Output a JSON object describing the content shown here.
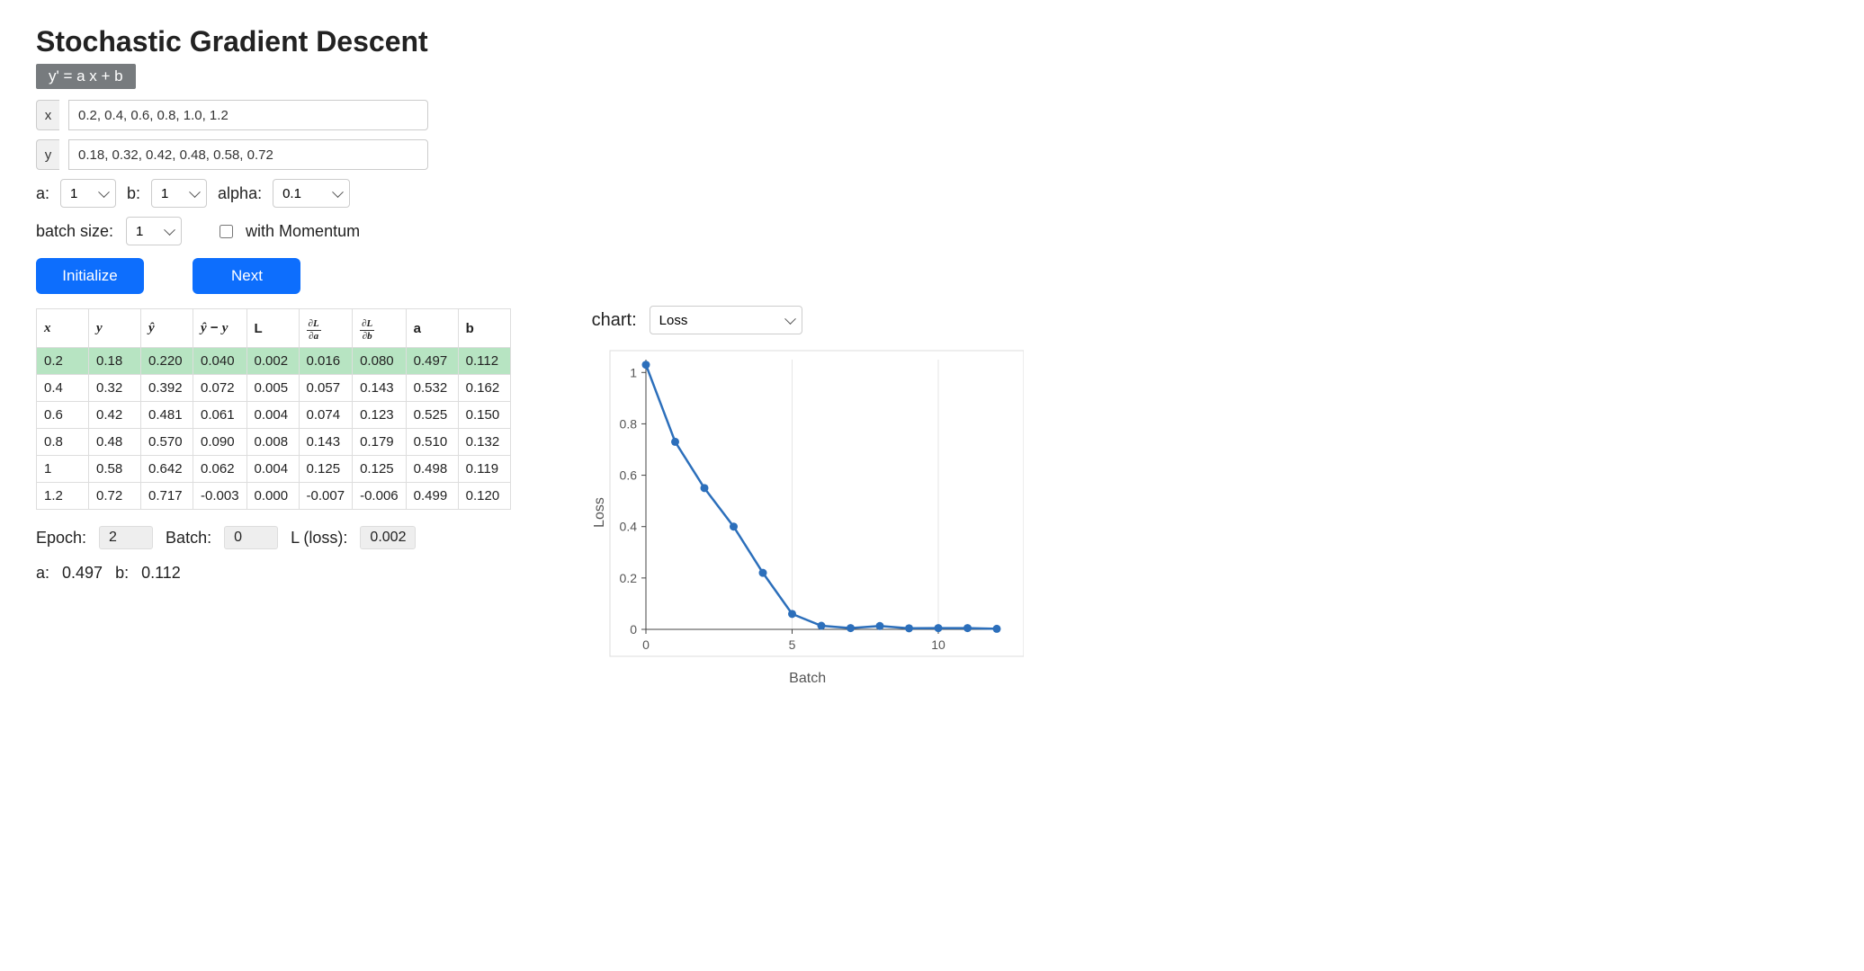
{
  "title": "Stochastic Gradient Descent",
  "equation": "y' = a x + b",
  "inputs": {
    "x_label": "x",
    "x_value": "0.2, 0.4, 0.6, 0.8, 1.0, 1.2",
    "y_label": "y",
    "y_value": "0.18, 0.32, 0.42, 0.48, 0.58, 0.72"
  },
  "params": {
    "a_label": "a:",
    "a_value": "1",
    "b_label": "b:",
    "b_value": "1",
    "alpha_label": "alpha:",
    "alpha_value": "0.1",
    "batch_label": "batch size:",
    "batch_value": "1",
    "momentum_label": "with Momentum",
    "momentum_checked": false
  },
  "buttons": {
    "initialize": "Initialize",
    "next": "Next"
  },
  "table": {
    "headers": [
      "x",
      "y",
      "ŷ",
      "ŷ − y",
      "L",
      "∂L/∂a",
      "∂L/∂b",
      "a",
      "b"
    ],
    "highlight_row": 0,
    "rows": [
      [
        "0.2",
        "0.18",
        "0.220",
        "0.040",
        "0.002",
        "0.016",
        "0.080",
        "0.497",
        "0.112"
      ],
      [
        "0.4",
        "0.32",
        "0.392",
        "0.072",
        "0.005",
        "0.057",
        "0.143",
        "0.532",
        "0.162"
      ],
      [
        "0.6",
        "0.42",
        "0.481",
        "0.061",
        "0.004",
        "0.074",
        "0.123",
        "0.525",
        "0.150"
      ],
      [
        "0.8",
        "0.48",
        "0.570",
        "0.090",
        "0.008",
        "0.143",
        "0.179",
        "0.510",
        "0.132"
      ],
      [
        "1",
        "0.58",
        "0.642",
        "0.062",
        "0.004",
        "0.125",
        "0.125",
        "0.498",
        "0.119"
      ],
      [
        "1.2",
        "0.72",
        "0.717",
        "-0.003",
        "0.000",
        "-0.007",
        "-0.006",
        "0.499",
        "0.120"
      ]
    ]
  },
  "status": {
    "epoch_label": "Epoch:",
    "epoch_value": "2",
    "batch_label": "Batch:",
    "batch_value": "0",
    "loss_label": "L (loss):",
    "loss_value": "0.002",
    "a_label": "a:",
    "a_value": "0.497",
    "b_label": "b:",
    "b_value": "0.112"
  },
  "chart_select": {
    "label": "chart:",
    "value": "Loss"
  },
  "chart_data": {
    "type": "line",
    "title": "",
    "xlabel": "Batch",
    "ylabel": "Loss",
    "xlim": [
      0,
      12
    ],
    "ylim": [
      0,
      1.05
    ],
    "x_ticks": [
      0,
      5,
      10
    ],
    "y_ticks": [
      0,
      0.2,
      0.4,
      0.6,
      0.8,
      1
    ],
    "x": [
      0,
      1,
      2,
      3,
      4,
      5,
      6,
      7,
      8,
      9,
      10,
      11,
      12
    ],
    "values": [
      1.03,
      0.73,
      0.55,
      0.4,
      0.22,
      0.06,
      0.014,
      0.005,
      0.013,
      0.004,
      0.005,
      0.005,
      0.002
    ]
  }
}
